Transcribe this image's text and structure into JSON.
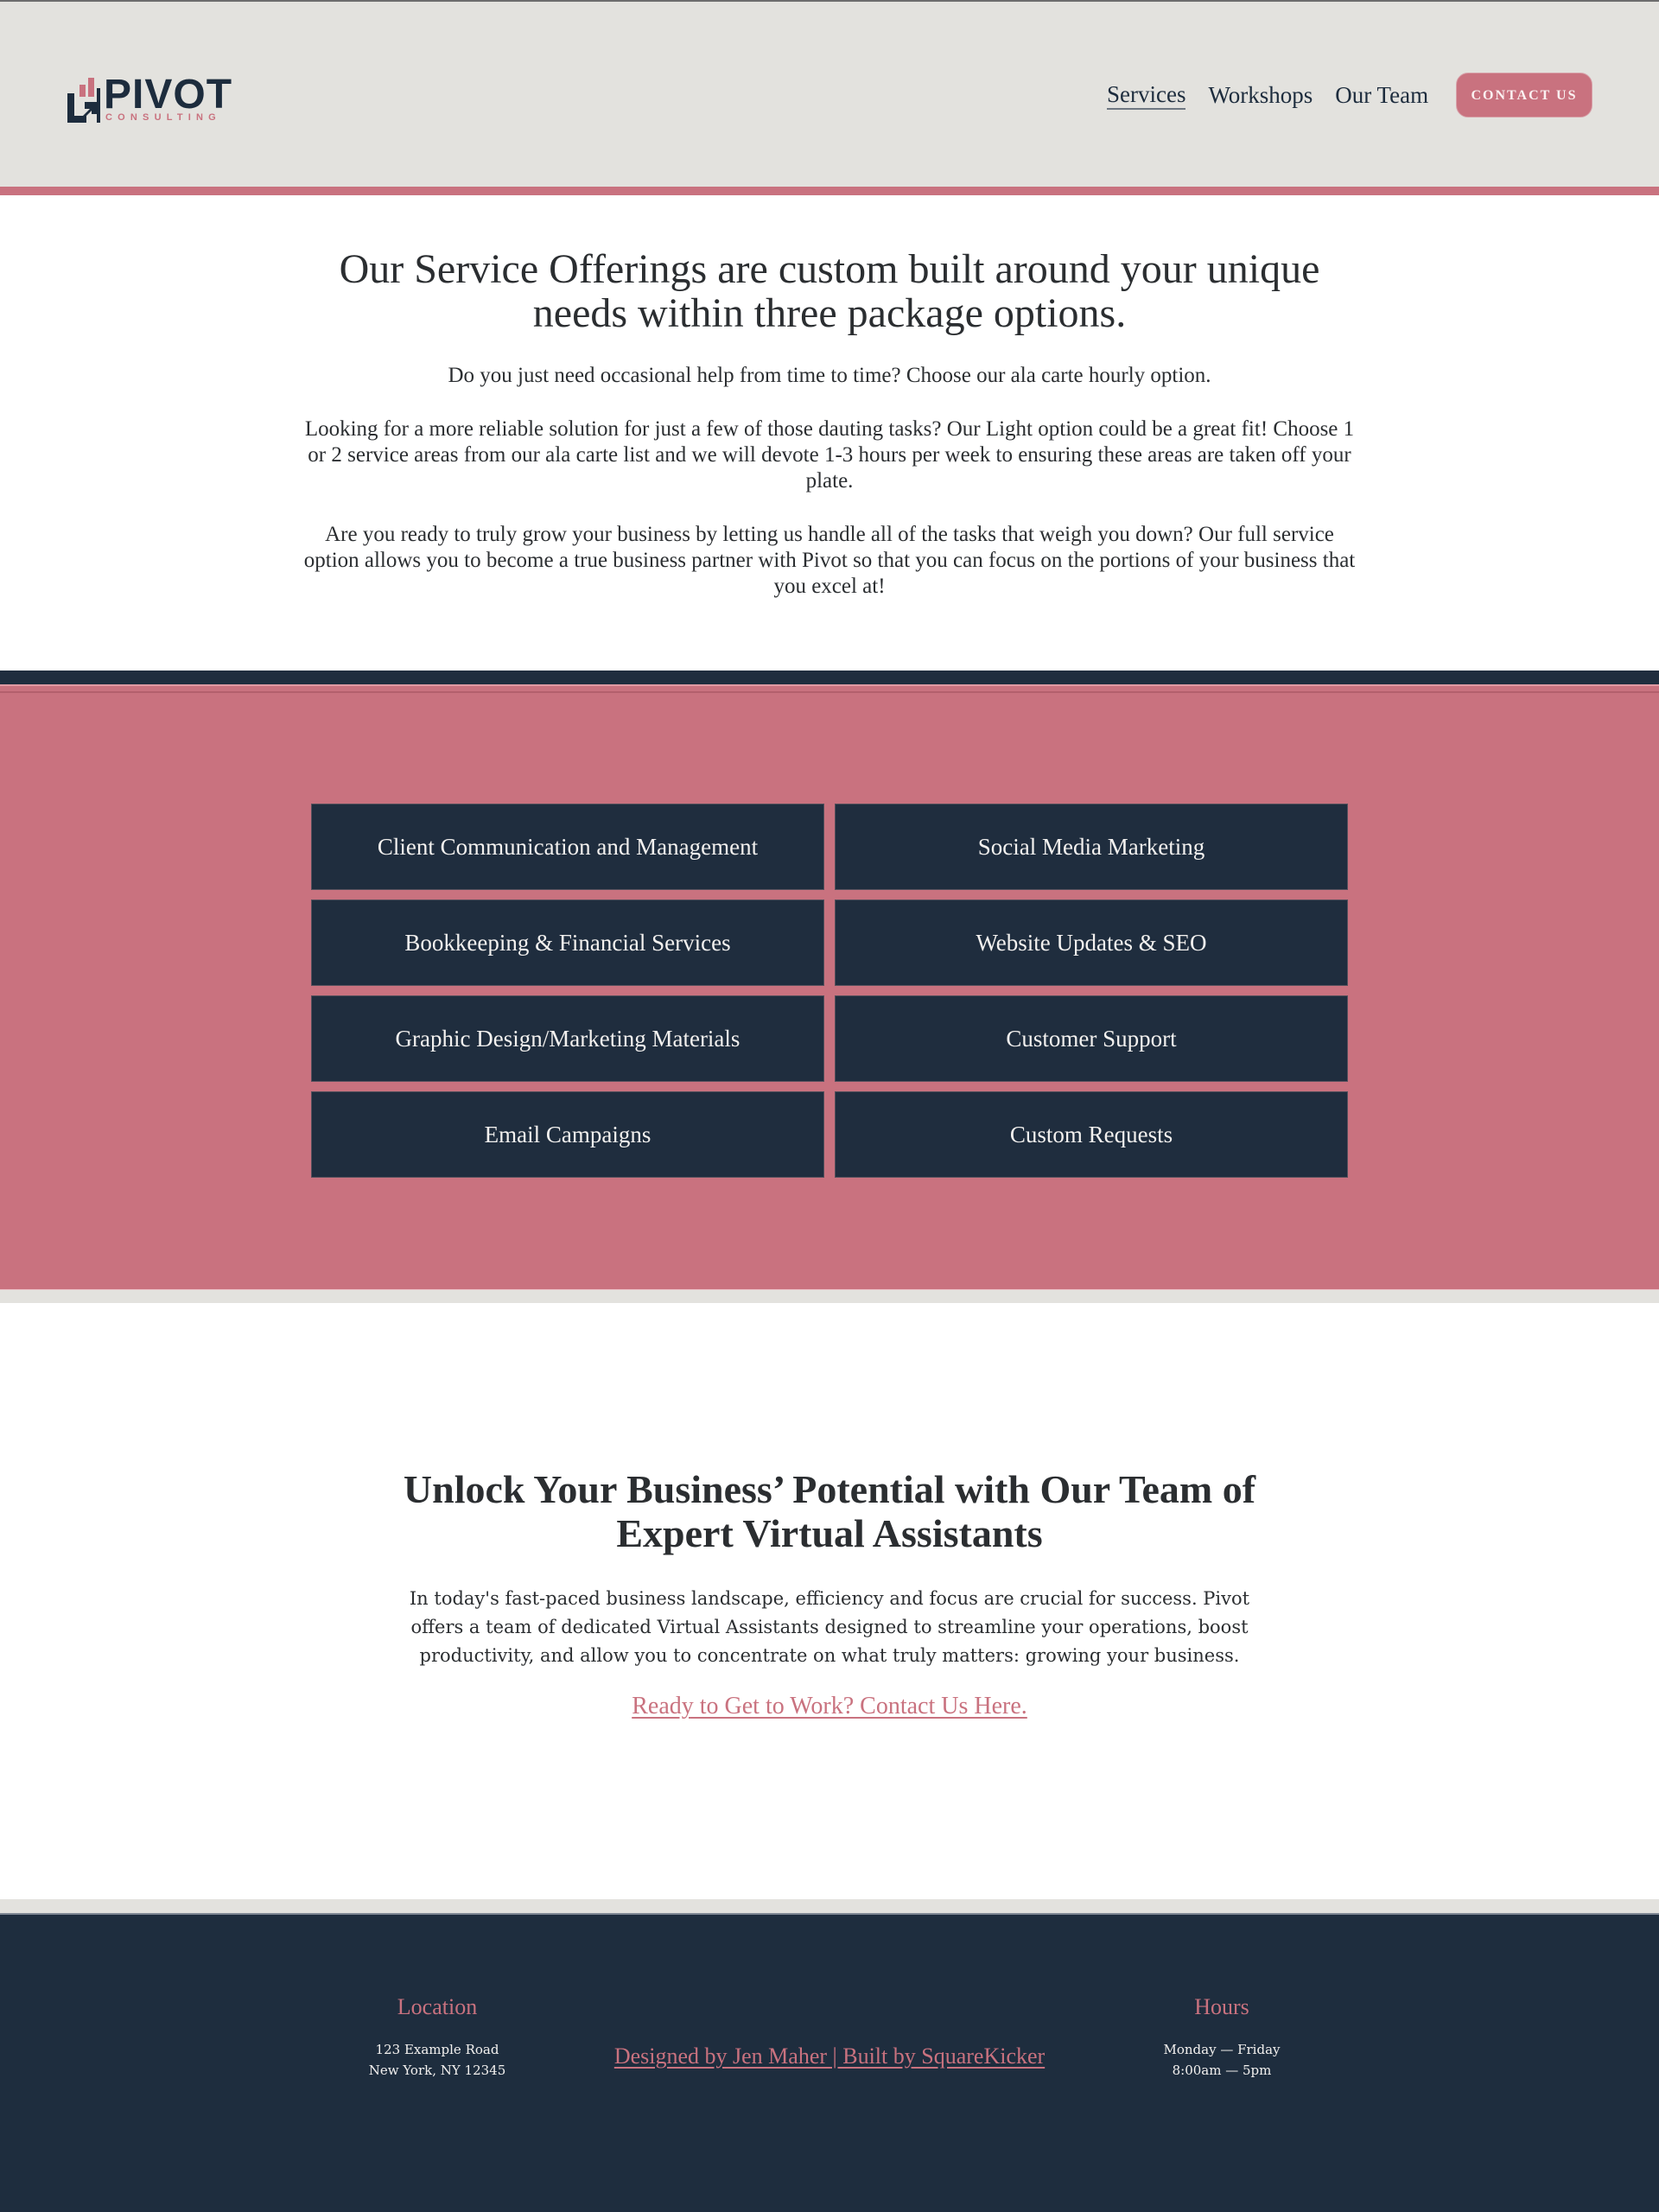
{
  "colors": {
    "accent_pink": "#c9727f",
    "navy": "#1f2d3e",
    "header_bg": "#e3e2de",
    "text_dark": "#2b2e31"
  },
  "header": {
    "logo": {
      "icon": "bar-chart-arrow-logo-icon",
      "word": "PIVOT",
      "sub": "CONSULTING"
    },
    "nav": [
      {
        "label": "Services",
        "active": true
      },
      {
        "label": "Workshops",
        "active": false
      },
      {
        "label": "Our Team",
        "active": false
      }
    ],
    "contact_button": "CONTACT US"
  },
  "intro": {
    "title": "Our Service Offerings are custom built around your unique needs within three package options.",
    "paragraphs": [
      "Do you just need occasional help from time to time? Choose our ala carte hourly option.",
      "Looking for a more reliable solution for just a few of those dauting tasks? Our Light option could be a great fit!  Choose 1 or 2 service areas from our ala carte list and we will devote 1-3 hours per week to ensuring these areas are taken off your plate.",
      "Are you ready to truly grow your business by letting us handle all of the tasks that weigh you down? Our full service option allows you to become a true business partner with Pivot so that you can focus on the portions of your business that you excel at!"
    ]
  },
  "services": {
    "items": [
      "Client Communication and Management",
      "Social Media Marketing",
      "Bookkeeping & Financial Services",
      "Website Updates & SEO",
      "Graphic Design/Marketing Materials",
      "Customer Support",
      "Email Campaigns",
      "Custom Requests"
    ]
  },
  "va": {
    "title": "Unlock Your Business’ Potential with Our Team of Expert Virtual Assistants",
    "body": "In today's fast-paced business landscape, efficiency and focus are crucial for success. Pivot offers a team of dedicated Virtual Assistants designed to streamline your operations, boost productivity, and allow you to concentrate on what truly matters: growing your business.",
    "cta": "Ready to Get to Work? Contact Us Here."
  },
  "footer": {
    "location": {
      "heading": "Location",
      "lines": [
        "123 Example Road",
        "New York, NY 12345"
      ]
    },
    "credit": "Designed by Jen Maher | Built by SquareKicker",
    "hours": {
      "heading": "Hours",
      "lines": [
        "Monday — Friday",
        "8:00am — 5pm"
      ]
    }
  }
}
